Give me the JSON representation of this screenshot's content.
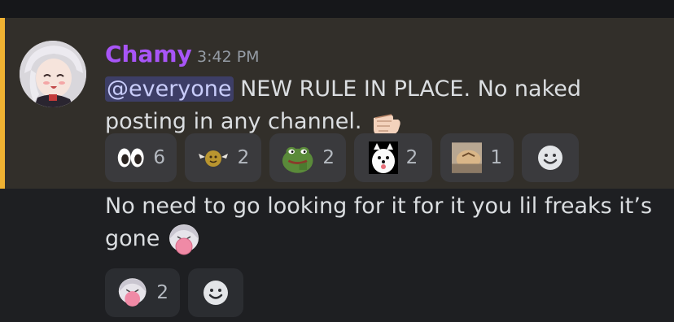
{
  "message1": {
    "author": "Chamy",
    "timestamp": "3:42 PM",
    "mention": "@everyone",
    "text_line1": " NEW RULE IN PLACE. No naked",
    "text_line2": "posting in any channel.",
    "reactions": [
      {
        "emoji": "eyes-emoji",
        "count": "6"
      },
      {
        "emoji": "winged-coin-emoji",
        "count": "2"
      },
      {
        "emoji": "pepe-frog-emoji",
        "count": "2"
      },
      {
        "emoji": "white-dog-emoji",
        "count": "2"
      },
      {
        "emoji": "cat-photo-emoji",
        "count": "1"
      }
    ]
  },
  "message2": {
    "text_line1": "No need to go looking for it for it you lil freaks it’s",
    "text_line2": "gone",
    "reactions": [
      {
        "emoji": "anime-girl-bubble-emoji",
        "count": "2"
      }
    ]
  },
  "colors": {
    "username": "#a855f7",
    "mention_bar": "#f0b232",
    "highlight_bg": "#322f2a",
    "background": "#1e1f22"
  }
}
